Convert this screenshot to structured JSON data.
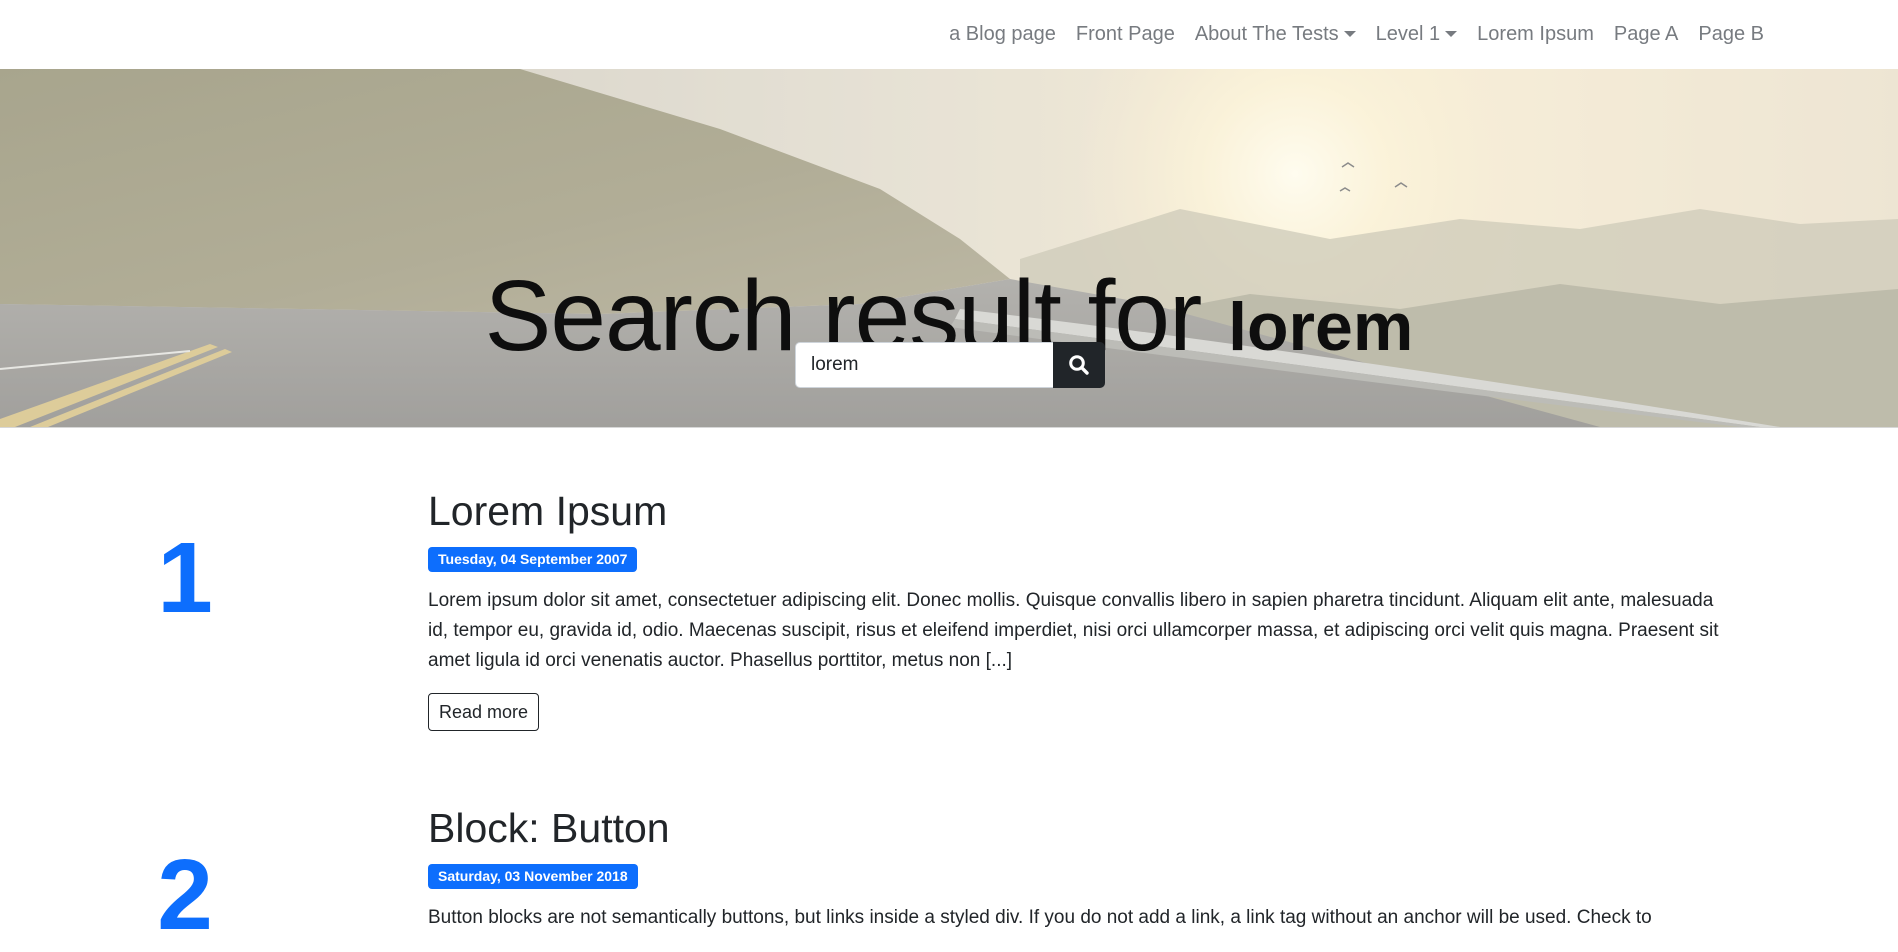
{
  "nav": {
    "items": [
      {
        "label": "a Blog page",
        "dropdown": false
      },
      {
        "label": "Front Page",
        "dropdown": false
      },
      {
        "label": "About The Tests",
        "dropdown": true
      },
      {
        "label": "Level 1",
        "dropdown": true
      },
      {
        "label": "Lorem Ipsum",
        "dropdown": false
      },
      {
        "label": "Page A",
        "dropdown": false
      },
      {
        "label": "Page B",
        "dropdown": false
      }
    ]
  },
  "hero": {
    "title_prefix": "Search result for",
    "search_term": "lorem",
    "search_value": "lorem",
    "search_icon": "search-icon"
  },
  "results": [
    {
      "number": "1",
      "title": "Lorem Ipsum",
      "date": "Tuesday, 04 September 2007",
      "excerpt": "Lorem ipsum dolor sit amet, consectetuer adipiscing elit. Donec mollis. Quisque convallis libero in sapien pharetra tincidunt. Aliquam elit ante, malesuada id, tempor eu, gravida id, odio. Maecenas suscipit, risus et eleifend imperdiet, nisi orci ullamcorper massa, et adipiscing orci velit quis magna. Praesent sit amet ligula id orci venenatis auctor. Phasellus porttitor, metus non [...]",
      "read_more": "Read more"
    },
    {
      "number": "2",
      "title": "Block: Button",
      "date": "Saturday, 03 November 2018",
      "excerpt": "Button blocks are not semantically buttons, but links inside a styled div.  If you do not add a link, a link tag without an anchor will be used. Check to"
    }
  ],
  "colors": {
    "accent": "#0d6efd",
    "dark": "#212529",
    "nav_text": "#777b80"
  }
}
